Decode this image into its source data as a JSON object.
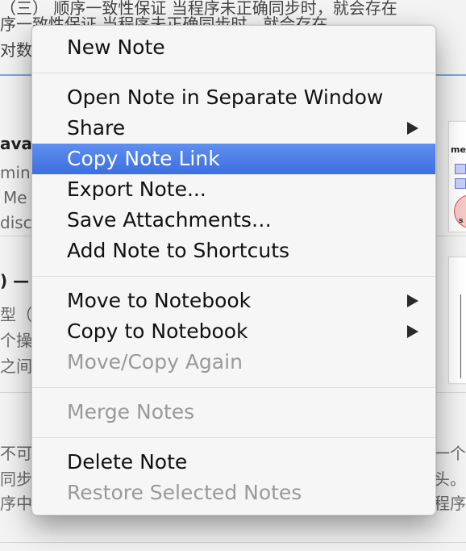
{
  "background": {
    "lines": [
      "（三）  顺序一致性保证 当程序未正确同步时，就会存在",
      "序一致性保证 当程序未正确同步时，就会存在",
      "对数",
      "ava",
      "ming",
      "Me",
      "disc",
      ")  —",
      "型（",
      "个操",
      "之间",
      "不可",
      "同步",
      "序中",
      "一个",
      "头。",
      "程序"
    ],
    "thumb_labels": [
      "me",
      "s"
    ]
  },
  "menu": {
    "items": [
      {
        "label": "New Note",
        "disabled": false,
        "submenu": false,
        "selected": false
      },
      {
        "label": "Open Note in Separate Window",
        "disabled": false,
        "submenu": false,
        "selected": false
      },
      {
        "label": "Share",
        "disabled": false,
        "submenu": true,
        "selected": false
      },
      {
        "label": "Copy Note Link",
        "disabled": false,
        "submenu": false,
        "selected": true
      },
      {
        "label": "Export Note...",
        "disabled": false,
        "submenu": false,
        "selected": false
      },
      {
        "label": "Save Attachments…",
        "disabled": false,
        "submenu": false,
        "selected": false
      },
      {
        "label": "Add Note to Shortcuts",
        "disabled": false,
        "submenu": false,
        "selected": false
      },
      {
        "label": "Move to Notebook",
        "disabled": false,
        "submenu": true,
        "selected": false
      },
      {
        "label": "Copy to Notebook",
        "disabled": false,
        "submenu": true,
        "selected": false
      },
      {
        "label": "Move/Copy Again",
        "disabled": true,
        "submenu": false,
        "selected": false
      },
      {
        "label": "Merge Notes",
        "disabled": true,
        "submenu": false,
        "selected": false
      },
      {
        "label": "Delete Note",
        "disabled": false,
        "submenu": false,
        "selected": false
      },
      {
        "label": "Restore Selected Notes",
        "disabled": true,
        "submenu": false,
        "selected": false
      }
    ]
  },
  "colors": {
    "selection": "#3c6fe0",
    "disabled_text": "#9a9a9a",
    "menu_background": "#f6f6f6"
  },
  "icons": {
    "submenu": "chevron-right-icon"
  }
}
